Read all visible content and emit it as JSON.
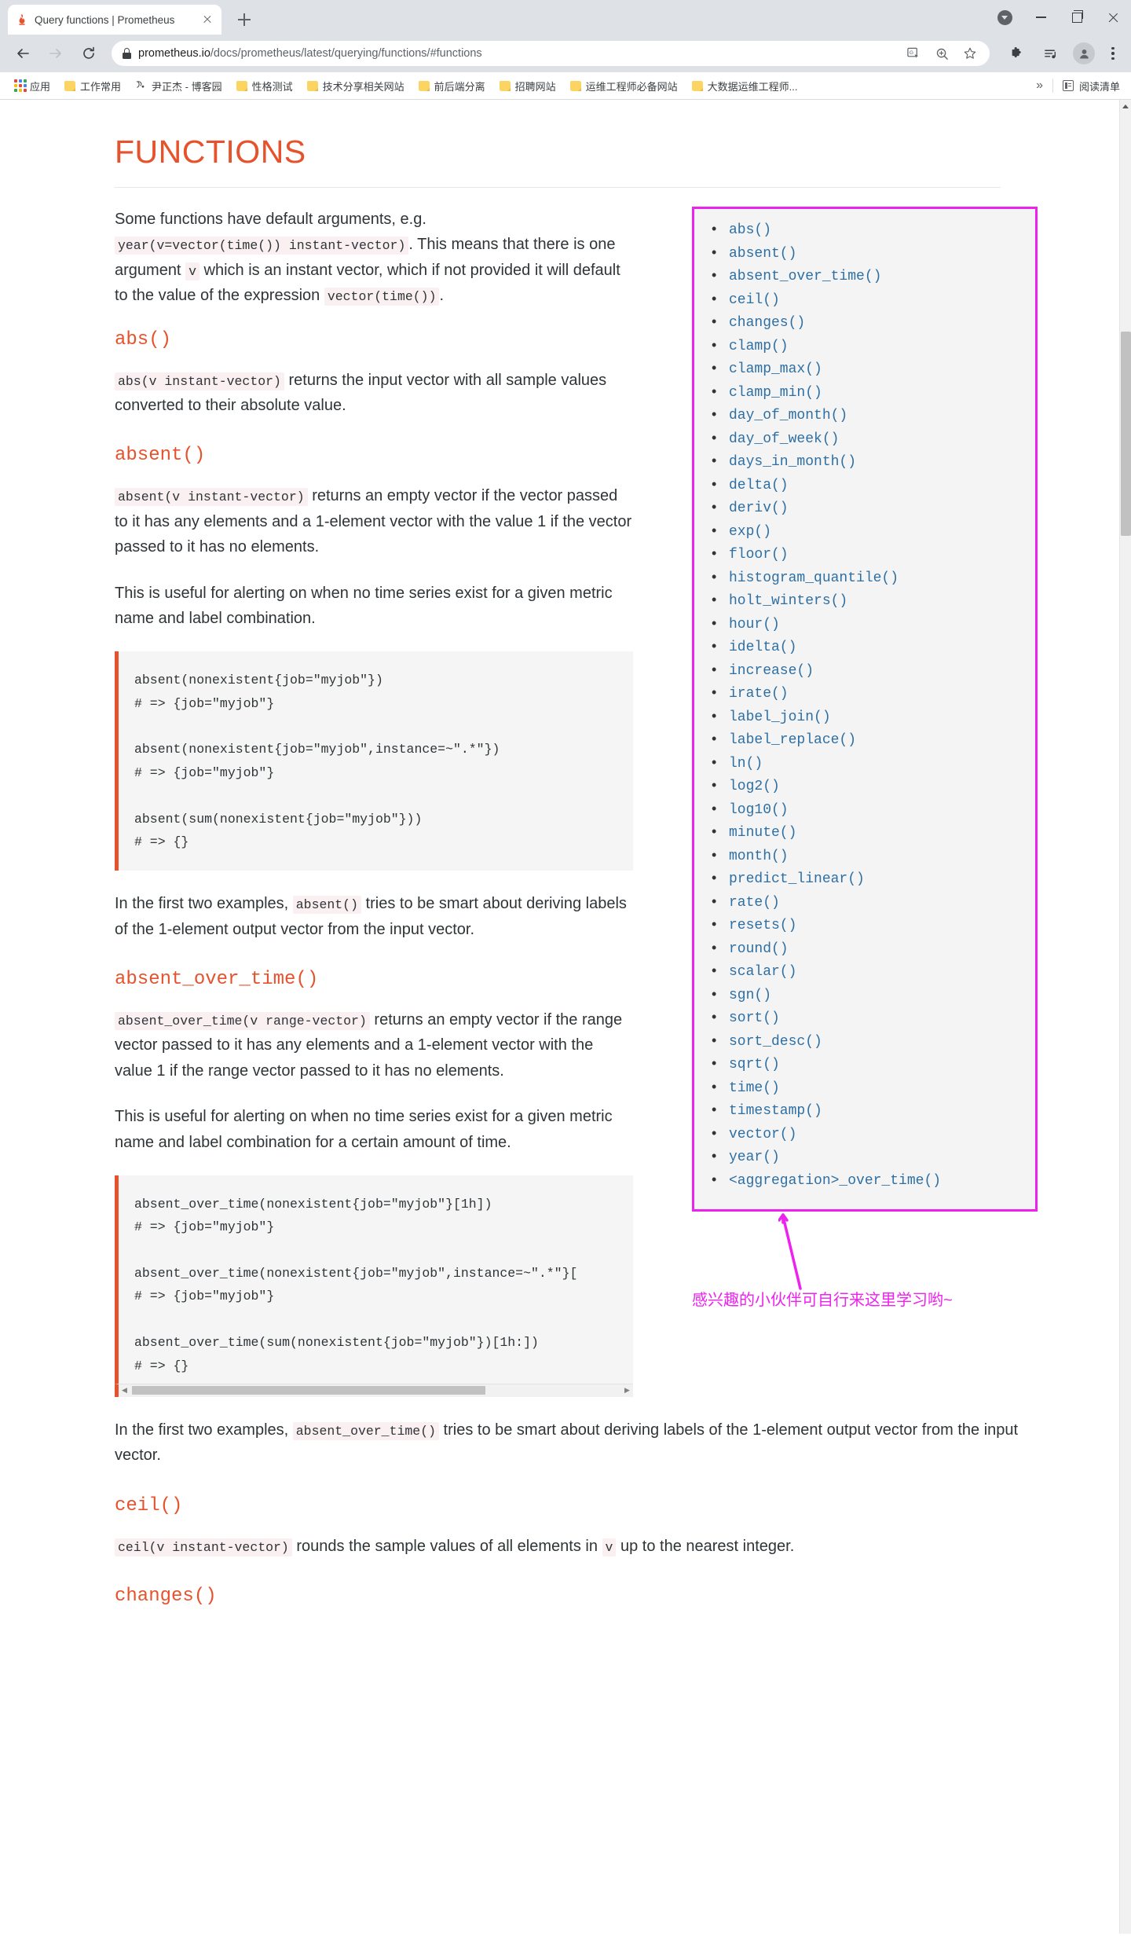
{
  "browser": {
    "tab": {
      "title": "Query functions | Prometheus",
      "favicon": "prometheus-icon",
      "close": "close-icon"
    },
    "new_tab_label": "+",
    "window_controls": [
      "update-available-icon",
      "minimize-icon",
      "maximize-icon",
      "close-window-icon"
    ],
    "nav": {
      "back": "back-arrow-icon",
      "forward": "forward-arrow-icon",
      "reload": "reload-icon"
    },
    "omnibox": {
      "lock": "lock-icon",
      "url_host": "prometheus.io",
      "url_path": "/docs/prometheus/latest/querying/functions/#functions",
      "icons": [
        "translate-icon",
        "zoom-icon",
        "bookmark-star-icon"
      ]
    },
    "toolbar_icons": [
      "extensions-puzzle-icon",
      "media-playlist-icon",
      "profile-avatar-icon",
      "chrome-menu-icon"
    ],
    "bookmarks": [
      {
        "label": "应用",
        "icon": "apps-grid-icon"
      },
      {
        "label": "工作常用",
        "icon": "folder-icon"
      },
      {
        "label": "尹正杰 - 博客园",
        "icon": "cnblogs-icon"
      },
      {
        "label": "性格测试",
        "icon": "folder-icon"
      },
      {
        "label": "技术分享相关网站",
        "icon": "folder-icon"
      },
      {
        "label": "前后端分离",
        "icon": "folder-icon"
      },
      {
        "label": "招聘网站",
        "icon": "folder-icon"
      },
      {
        "label": "运维工程师必备网站",
        "icon": "folder-icon"
      },
      {
        "label": "大数据运维工程师...",
        "icon": "folder-icon"
      }
    ],
    "bookmarks_overflow": "»",
    "reading_list": {
      "label": "阅读清单",
      "icon": "reading-list-icon"
    }
  },
  "page": {
    "title": "FUNCTIONS",
    "intro": {
      "part1": "Some functions have default arguments, e.g. ",
      "code1": "year(v=vector(time()) instant-vector)",
      "part2": ". This means that there is one argument ",
      "code2": "v",
      "part3": " which is an instant vector, which if not provided it will default to the value of the expression ",
      "code3": "vector(time())",
      "part4": "."
    },
    "sections": [
      {
        "heading": "abs()",
        "p1_code": "abs(v instant-vector)",
        "p1_text": " returns the input vector with all sample values converted to their absolute value."
      },
      {
        "heading": "absent()",
        "p1_code": "absent(v instant-vector)",
        "p1_text": " returns an empty vector if the vector passed to it has any elements and a 1-element vector with the value 1 if the vector passed to it has no elements.",
        "p2": "This is useful for alerting on when no time series exist for a given metric name and label combination.",
        "code_block": "absent(nonexistent{job=\"myjob\"})\n# => {job=\"myjob\"}\n\nabsent(nonexistent{job=\"myjob\",instance=~\".*\"})\n# => {job=\"myjob\"}\n\nabsent(sum(nonexistent{job=\"myjob\"}))\n# => {}",
        "p3_pre": "In the first two examples, ",
        "p3_code": "absent()",
        "p3_post": " tries to be smart about deriving labels of the 1-element output vector from the input vector."
      },
      {
        "heading": "absent_over_time()",
        "p1_code": "absent_over_time(v range-vector)",
        "p1_text": " returns an empty vector if the range vector passed to it has any elements and a 1-element vector with the value 1 if the range vector passed to it has no elements.",
        "p2": "This is useful for alerting on when no time series exist for a given metric name and label combination for a certain amount of time.",
        "code_block": "absent_over_time(nonexistent{job=\"myjob\"}[1h])\n# => {job=\"myjob\"}\n\nabsent_over_time(nonexistent{job=\"myjob\",instance=~\".*\"}[\n# => {job=\"myjob\"}\n\nabsent_over_time(sum(nonexistent{job=\"myjob\"})[1h:])\n# => {}",
        "has_hscroll": true,
        "p3_pre": "In the first two examples, ",
        "p3_code": "absent_over_time()",
        "p3_post": " tries to be smart about deriving labels of the 1-element output vector from the input vector."
      },
      {
        "heading": "ceil()",
        "p1_code": "ceil(v instant-vector)",
        "p1_text": " rounds the sample values of all elements in ",
        "p1_code2": "v",
        "p1_text2": " up to the nearest integer."
      },
      {
        "heading": "changes()"
      }
    ],
    "function_index": {
      "border_color": "#ee22ee",
      "link_color": "#2e6fa3",
      "items": [
        "abs()",
        "absent()",
        "absent_over_time()",
        "ceil()",
        "changes()",
        "clamp()",
        "clamp_max()",
        "clamp_min()",
        "day_of_month()",
        "day_of_week()",
        "days_in_month()",
        "delta()",
        "deriv()",
        "exp()",
        "floor()",
        "histogram_quantile()",
        "holt_winters()",
        "hour()",
        "idelta()",
        "increase()",
        "irate()",
        "label_join()",
        "label_replace()",
        "ln()",
        "log2()",
        "log10()",
        "minute()",
        "month()",
        "predict_linear()",
        "rate()",
        "resets()",
        "round()",
        "scalar()",
        "sgn()",
        "sort()",
        "sort_desc()",
        "sqrt()",
        "time()",
        "timestamp()",
        "vector()",
        "year()",
        "<aggregation>_over_time()"
      ]
    },
    "annotation": {
      "text": "感兴趣的小伙伴可自行来这里学习哟~",
      "color": "#ee22ee"
    }
  },
  "colors": {
    "accent": "#e6522c",
    "link": "#2e6fa3",
    "annotation": "#ee22ee",
    "chrome_bg": "#dee1e6"
  }
}
